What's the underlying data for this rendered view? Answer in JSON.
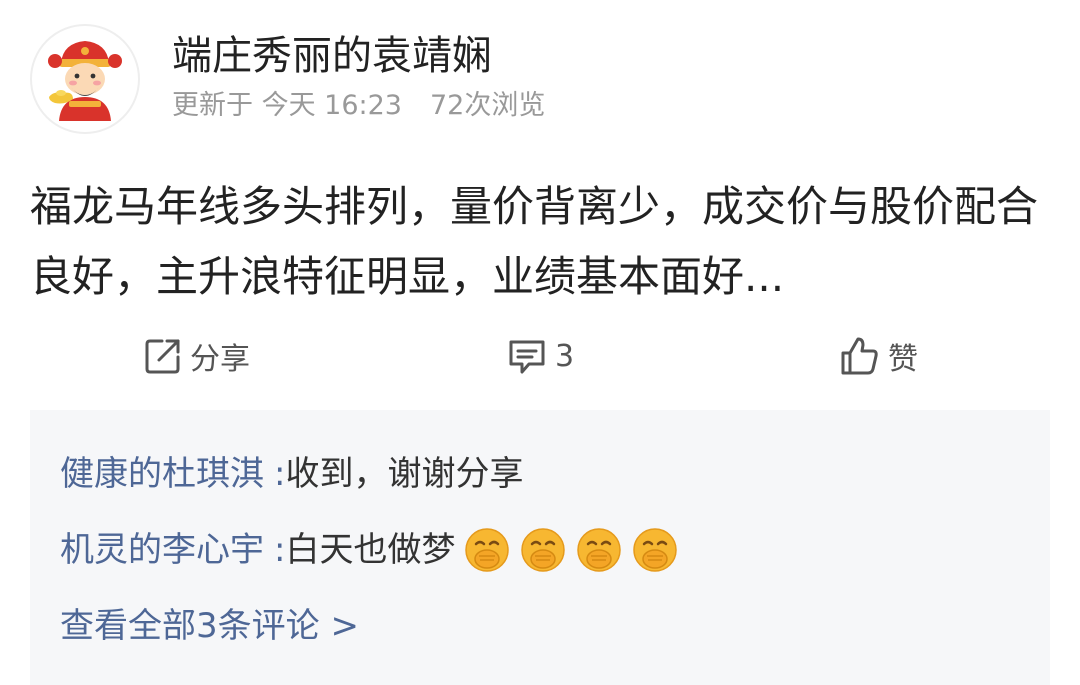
{
  "author": {
    "name": "端庄秀丽的袁靖娴",
    "avatar": "cartoon-god-of-wealth-avatar"
  },
  "meta": {
    "updated": "更新于 今天 16:23",
    "views": "72次浏览"
  },
  "post": {
    "text": "福龙马年线多头排列，量价背离少，成交价与股价配合良好，主升浪特征明显，业绩基本面好..."
  },
  "actions": {
    "share_icon": "share-icon",
    "share_label": "分享",
    "comment_icon": "comment-icon",
    "comment_count": "3",
    "like_icon": "thumbs-up-icon",
    "like_label": "赞"
  },
  "comments": [
    {
      "user": "健康的杜琪淇",
      "separator": ":",
      "text": "收到，谢谢分享"
    },
    {
      "user": "机灵的李心宇",
      "separator": ":",
      "text": "白天也做梦",
      "emojis": [
        "laughing-covering-mouth-emoji",
        "laughing-covering-mouth-emoji",
        "laughing-covering-mouth-emoji",
        "laughing-covering-mouth-emoji"
      ]
    }
  ],
  "view_all": "查看全部3条评论 >",
  "colors": {
    "link_blue": "#4e6796",
    "meta_gray": "#999999",
    "comment_bg": "#f6f7f9",
    "emoji_yellow": "#f7b731"
  }
}
